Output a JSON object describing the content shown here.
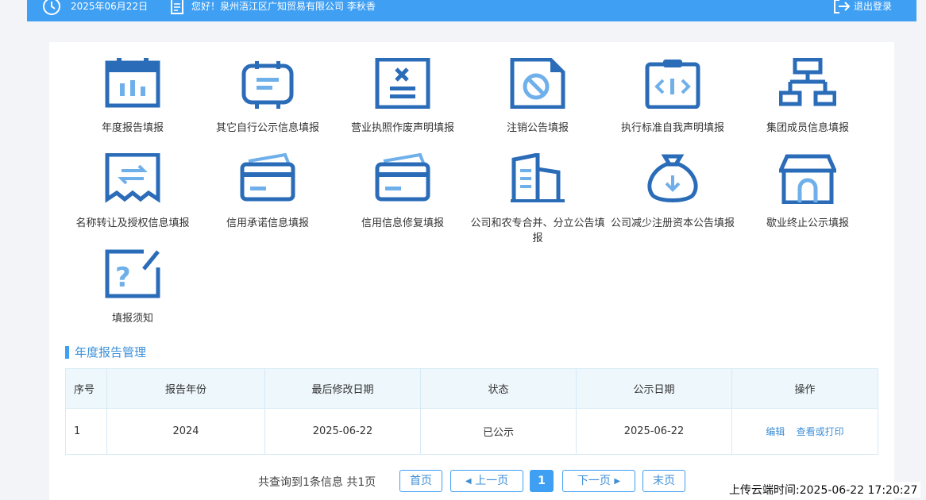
{
  "topbar": {
    "date": "2025年06月22日",
    "greeting": "您好！泉州浯江区广知贸易有限公司 李秋香",
    "logout": "退出登录",
    "color": "#3f9ff3"
  },
  "tiles": [
    {
      "label": "年度报告填报",
      "icon": "calendar-icon"
    },
    {
      "label": "其它自行公示信息填报",
      "icon": "scroll-icon"
    },
    {
      "label": "营业执照作废声明填报",
      "icon": "void-document-icon"
    },
    {
      "label": "注销公告填报",
      "icon": "cancel-document-icon"
    },
    {
      "label": "执行标准自我声明填报",
      "icon": "code-clipboard-icon"
    },
    {
      "label": "集团成员信息填报",
      "icon": "org-chart-icon"
    },
    {
      "label": "名称转让及授权信息填报",
      "icon": "transfer-icon"
    },
    {
      "label": "信用承诺信息填报",
      "icon": "credit-card-icon"
    },
    {
      "label": "信用信息修复填报",
      "icon": "credit-card-icon"
    },
    {
      "label": "公司和农专合并、分立公告填报",
      "icon": "buildings-icon"
    },
    {
      "label": "公司减少注册资本公告填报",
      "icon": "money-bag-icon"
    },
    {
      "label": "歇业终止公示填报",
      "icon": "store-icon"
    },
    {
      "label": "填报须知",
      "icon": "question-note-icon"
    }
  ],
  "section": {
    "title": "年度报告管理"
  },
  "table": {
    "headers": [
      "序号",
      "报告年份",
      "最后修改日期",
      "状态",
      "公示日期",
      "操作"
    ],
    "rows": [
      {
        "idx": "1",
        "year": "2024",
        "modified": "2025-06-22",
        "status": "已公示",
        "publish_date": "2025-06-22",
        "actions": [
          "编辑",
          "查看或打印"
        ]
      }
    ]
  },
  "pager": {
    "info": "共查询到1条信息 共1页",
    "first": "首页",
    "prev": "上一页",
    "current": "1",
    "next": "下一页",
    "last": "末页"
  },
  "upload_time": "上传云端时间:2025-06-22 17:20:27",
  "colors": {
    "accent": "#3f9ff3",
    "icon_dark": "#2b6cb8",
    "icon_light": "#6fb0ea"
  }
}
